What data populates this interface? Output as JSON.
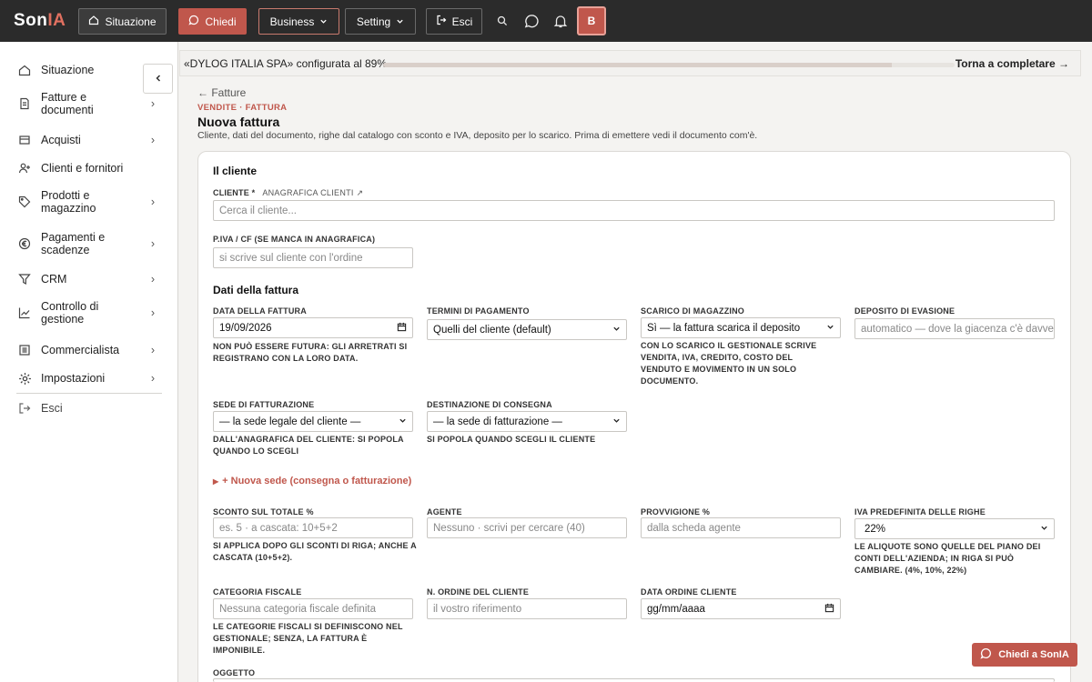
{
  "brand": {
    "name_prefix": "Son",
    "name_suffix": "IA"
  },
  "topbar": {
    "situazione": "Situazione",
    "chiedi": "Chiedi",
    "business": "Business",
    "setting": "Setting",
    "esci": "Esci",
    "avatar_initial": "B"
  },
  "sidebar": {
    "items": [
      {
        "label": "Situazione",
        "icon": "home-icon"
      },
      {
        "label": "Fatture e documenti",
        "icon": "document-icon"
      },
      {
        "label": "Acquisti",
        "icon": "cart-icon"
      },
      {
        "label": "Clienti e fornitori",
        "icon": "user-add-icon"
      },
      {
        "label": "Prodotti e magazzino",
        "icon": "tag-icon"
      },
      {
        "label": "Pagamenti e scadenze",
        "icon": "euro-icon"
      },
      {
        "label": "CRM",
        "icon": "filter-icon"
      },
      {
        "label": "Controllo di gestione",
        "icon": "chart-icon"
      },
      {
        "label": "Commercialista",
        "icon": "list-icon"
      },
      {
        "label": "Impostazioni",
        "icon": "gear-icon"
      }
    ],
    "logout": "Esci"
  },
  "progress": {
    "text": "«DYLOG ITALIA SPA» configurata al 89%",
    "value_percent": 89,
    "link": "Torna a completare →"
  },
  "page": {
    "back": "← Fatture",
    "kicker": "VENDITE · FATTURA",
    "title": "Nuova fattura",
    "subtitle": "Cliente, dati del documento, righe dal catalogo con sconto e IVA, deposito per lo scarico. Prima di emettere vedi il documento com'è."
  },
  "form": {
    "section_cliente": "Il cliente",
    "cliente_label": "CLIENTE *",
    "anagrafica_link": "ANAGRAFICA CLIENTI ↗",
    "cliente_placeholder": "Cerca il cliente...",
    "piva_label": "P.IVA / CF (SE MANCA IN ANAGRAFICA)",
    "piva_placeholder": "si scrive sul cliente con l'ordine",
    "section_dati": "Dati della fattura",
    "data_label": "DATA DELLA FATTURA",
    "data_value": "19/09/2026",
    "data_hint": "NON PUÒ ESSERE FUTURA: GLI ARRETRATI SI REGISTRANO CON LA LORO DATA.",
    "termini_label": "TERMINI DI PAGAMENTO",
    "termini_value": "Quelli del cliente (default)",
    "scarico_label": "SCARICO DI MAGAZZINO",
    "scarico_value": "Sì — la fattura scarica il deposito",
    "scarico_hint": "CON LO SCARICO IL GESTIONALE SCRIVE VENDITA, IVA, CREDITO, COSTO DEL VENDUTO E MOVIMENTO IN UN SOLO DOCUMENTO.",
    "deposito_label": "DEPOSITO DI EVASIONE",
    "deposito_placeholder": "automatico — dove la giacenza c'è davvero",
    "sede_label": "SEDE DI FATTURAZIONE",
    "sede_value": "— la sede legale del cliente —",
    "sede_hint": "DALL'ANAGRAFICA DEL CLIENTE: SI POPOLA QUANDO LO SCEGLI",
    "dest_label": "DESTINAZIONE DI CONSEGNA",
    "dest_value": "— la sede di fatturazione —",
    "dest_hint": "SI POPOLA QUANDO SCEGLI IL CLIENTE",
    "nuova_sede": "+ Nuova sede (consegna o fatturazione)",
    "sconto_label": "SCONTO SUL TOTALE %",
    "sconto_placeholder": "es. 5 · a cascata: 10+5+2",
    "sconto_hint": "SI APPLICA DOPO GLI SCONTI DI RIGA; ANCHE A CASCATA (10+5+2).",
    "agente_label": "AGENTE",
    "agente_placeholder": "Nessuno · scrivi per cercare (40)",
    "provv_label": "PROVVIGIONE %",
    "provv_placeholder": "dalla scheda agente",
    "iva_label": "IVA PREDEFINITA DELLE RIGHE",
    "iva_value": "22%",
    "iva_hint": "LE ALIQUOTE SONO QUELLE DEL PIANO DEI CONTI DELL'AZIENDA; IN RIGA SI PUÒ CAMBIARE. (4%, 10%, 22%)",
    "catfisc_label": "CATEGORIA FISCALE",
    "catfisc_placeholder": "Nessuna categoria fiscale definita",
    "catfisc_hint": "LE CATEGORIE FISCALI SI DEFINISCONO NEL GESTIONALE; SENZA, LA FATTURA È IMPONIBILE.",
    "ordine_label": "N. ORDINE DEL CLIENTE",
    "ordine_placeholder": "il vostro riferimento",
    "dataord_label": "DATA ORDINE CLIENTE",
    "dataord_placeholder": "gg/mm/aaaa",
    "oggetto_label": "OGGETTO"
  },
  "fab": {
    "label": "Chiedi a SonIA"
  }
}
